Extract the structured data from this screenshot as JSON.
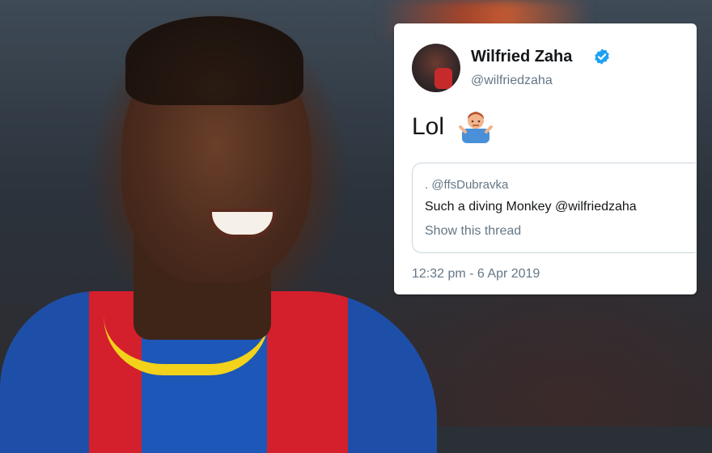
{
  "tweet": {
    "display_name": "Wilfried Zaha",
    "handle": "@wilfriedzaha",
    "text": "Lol",
    "verified_icon": "verified-badge-icon",
    "emoji_icon": "man-shrugging-icon",
    "quoted": {
      "author": ". @ffsDubravka",
      "text": "Such a diving Monkey @wilfriedzaha",
      "link": "Show this thread"
    },
    "timestamp": "12:32 pm - 6 Apr 2019"
  },
  "colors": {
    "verified": "#1da1f2",
    "card_bg": "#ffffff",
    "secondary_text": "#657786"
  }
}
